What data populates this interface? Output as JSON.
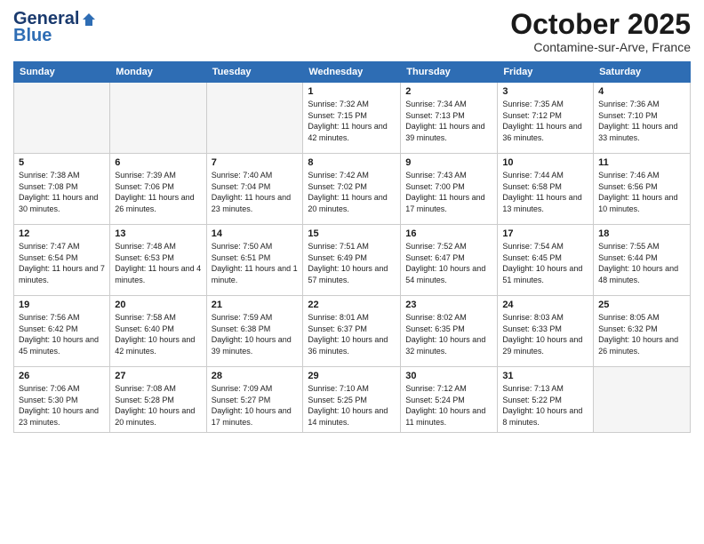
{
  "header": {
    "logo_line1": "General",
    "logo_line2": "Blue",
    "month": "October 2025",
    "location": "Contamine-sur-Arve, France"
  },
  "weekdays": [
    "Sunday",
    "Monday",
    "Tuesday",
    "Wednesday",
    "Thursday",
    "Friday",
    "Saturday"
  ],
  "weeks": [
    [
      {
        "day": "",
        "info": ""
      },
      {
        "day": "",
        "info": ""
      },
      {
        "day": "",
        "info": ""
      },
      {
        "day": "1",
        "info": "Sunrise: 7:32 AM\nSunset: 7:15 PM\nDaylight: 11 hours and 42 minutes."
      },
      {
        "day": "2",
        "info": "Sunrise: 7:34 AM\nSunset: 7:13 PM\nDaylight: 11 hours and 39 minutes."
      },
      {
        "day": "3",
        "info": "Sunrise: 7:35 AM\nSunset: 7:12 PM\nDaylight: 11 hours and 36 minutes."
      },
      {
        "day": "4",
        "info": "Sunrise: 7:36 AM\nSunset: 7:10 PM\nDaylight: 11 hours and 33 minutes."
      }
    ],
    [
      {
        "day": "5",
        "info": "Sunrise: 7:38 AM\nSunset: 7:08 PM\nDaylight: 11 hours and 30 minutes."
      },
      {
        "day": "6",
        "info": "Sunrise: 7:39 AM\nSunset: 7:06 PM\nDaylight: 11 hours and 26 minutes."
      },
      {
        "day": "7",
        "info": "Sunrise: 7:40 AM\nSunset: 7:04 PM\nDaylight: 11 hours and 23 minutes."
      },
      {
        "day": "8",
        "info": "Sunrise: 7:42 AM\nSunset: 7:02 PM\nDaylight: 11 hours and 20 minutes."
      },
      {
        "day": "9",
        "info": "Sunrise: 7:43 AM\nSunset: 7:00 PM\nDaylight: 11 hours and 17 minutes."
      },
      {
        "day": "10",
        "info": "Sunrise: 7:44 AM\nSunset: 6:58 PM\nDaylight: 11 hours and 13 minutes."
      },
      {
        "day": "11",
        "info": "Sunrise: 7:46 AM\nSunset: 6:56 PM\nDaylight: 11 hours and 10 minutes."
      }
    ],
    [
      {
        "day": "12",
        "info": "Sunrise: 7:47 AM\nSunset: 6:54 PM\nDaylight: 11 hours and 7 minutes."
      },
      {
        "day": "13",
        "info": "Sunrise: 7:48 AM\nSunset: 6:53 PM\nDaylight: 11 hours and 4 minutes."
      },
      {
        "day": "14",
        "info": "Sunrise: 7:50 AM\nSunset: 6:51 PM\nDaylight: 11 hours and 1 minute."
      },
      {
        "day": "15",
        "info": "Sunrise: 7:51 AM\nSunset: 6:49 PM\nDaylight: 10 hours and 57 minutes."
      },
      {
        "day": "16",
        "info": "Sunrise: 7:52 AM\nSunset: 6:47 PM\nDaylight: 10 hours and 54 minutes."
      },
      {
        "day": "17",
        "info": "Sunrise: 7:54 AM\nSunset: 6:45 PM\nDaylight: 10 hours and 51 minutes."
      },
      {
        "day": "18",
        "info": "Sunrise: 7:55 AM\nSunset: 6:44 PM\nDaylight: 10 hours and 48 minutes."
      }
    ],
    [
      {
        "day": "19",
        "info": "Sunrise: 7:56 AM\nSunset: 6:42 PM\nDaylight: 10 hours and 45 minutes."
      },
      {
        "day": "20",
        "info": "Sunrise: 7:58 AM\nSunset: 6:40 PM\nDaylight: 10 hours and 42 minutes."
      },
      {
        "day": "21",
        "info": "Sunrise: 7:59 AM\nSunset: 6:38 PM\nDaylight: 10 hours and 39 minutes."
      },
      {
        "day": "22",
        "info": "Sunrise: 8:01 AM\nSunset: 6:37 PM\nDaylight: 10 hours and 36 minutes."
      },
      {
        "day": "23",
        "info": "Sunrise: 8:02 AM\nSunset: 6:35 PM\nDaylight: 10 hours and 32 minutes."
      },
      {
        "day": "24",
        "info": "Sunrise: 8:03 AM\nSunset: 6:33 PM\nDaylight: 10 hours and 29 minutes."
      },
      {
        "day": "25",
        "info": "Sunrise: 8:05 AM\nSunset: 6:32 PM\nDaylight: 10 hours and 26 minutes."
      }
    ],
    [
      {
        "day": "26",
        "info": "Sunrise: 7:06 AM\nSunset: 5:30 PM\nDaylight: 10 hours and 23 minutes."
      },
      {
        "day": "27",
        "info": "Sunrise: 7:08 AM\nSunset: 5:28 PM\nDaylight: 10 hours and 20 minutes."
      },
      {
        "day": "28",
        "info": "Sunrise: 7:09 AM\nSunset: 5:27 PM\nDaylight: 10 hours and 17 minutes."
      },
      {
        "day": "29",
        "info": "Sunrise: 7:10 AM\nSunset: 5:25 PM\nDaylight: 10 hours and 14 minutes."
      },
      {
        "day": "30",
        "info": "Sunrise: 7:12 AM\nSunset: 5:24 PM\nDaylight: 10 hours and 11 minutes."
      },
      {
        "day": "31",
        "info": "Sunrise: 7:13 AM\nSunset: 5:22 PM\nDaylight: 10 hours and 8 minutes."
      },
      {
        "day": "",
        "info": ""
      }
    ]
  ]
}
